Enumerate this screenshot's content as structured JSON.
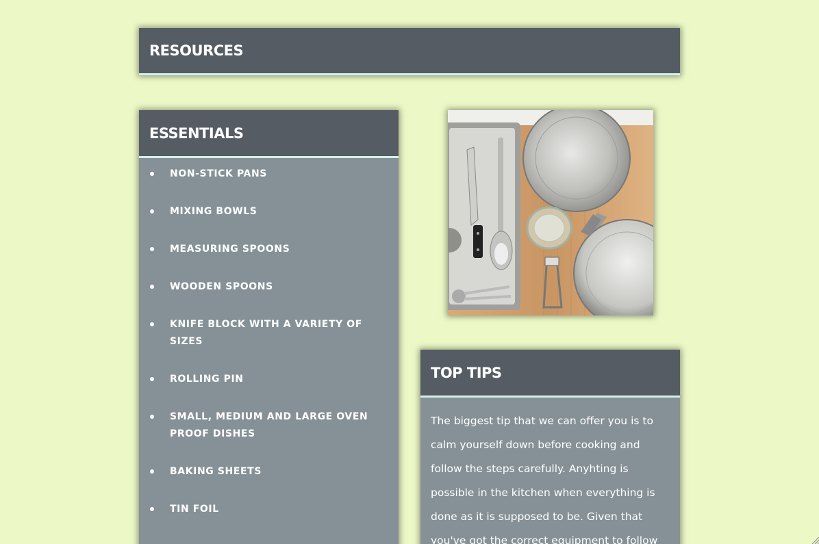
{
  "resources": {
    "title": "RESOURCES"
  },
  "essentials": {
    "title": "ESSENTIALS",
    "items": [
      "NON-STICK PANS",
      "MIXING BOWLS",
      "MEASURING SPOONS",
      "WOODEN SPOONS",
      "KNIFE BLOCK WITH A VARIETY OF SIZES",
      "ROLLING PIN",
      "SMALL, MEDIUM AND LARGE OVEN PROOF DISHES",
      "BAKING SHEETS",
      "TIN FOIL"
    ]
  },
  "photo": {
    "icon": "kitchen-utensils-photo"
  },
  "tips": {
    "title": "TOP TIPS",
    "body": "The biggest tip that we can offer you is to calm yourself down before cooking and follow the steps carefully. Anyhting is possible in the kitchen when everything is done as it is supposed to be. Given that you've got the correct equipment to follow"
  },
  "colors": {
    "background": "#ecf8c6",
    "header": "#565c63",
    "panel": "#869197",
    "accent_border": "#d4f1ec",
    "text": "#ffffff"
  }
}
